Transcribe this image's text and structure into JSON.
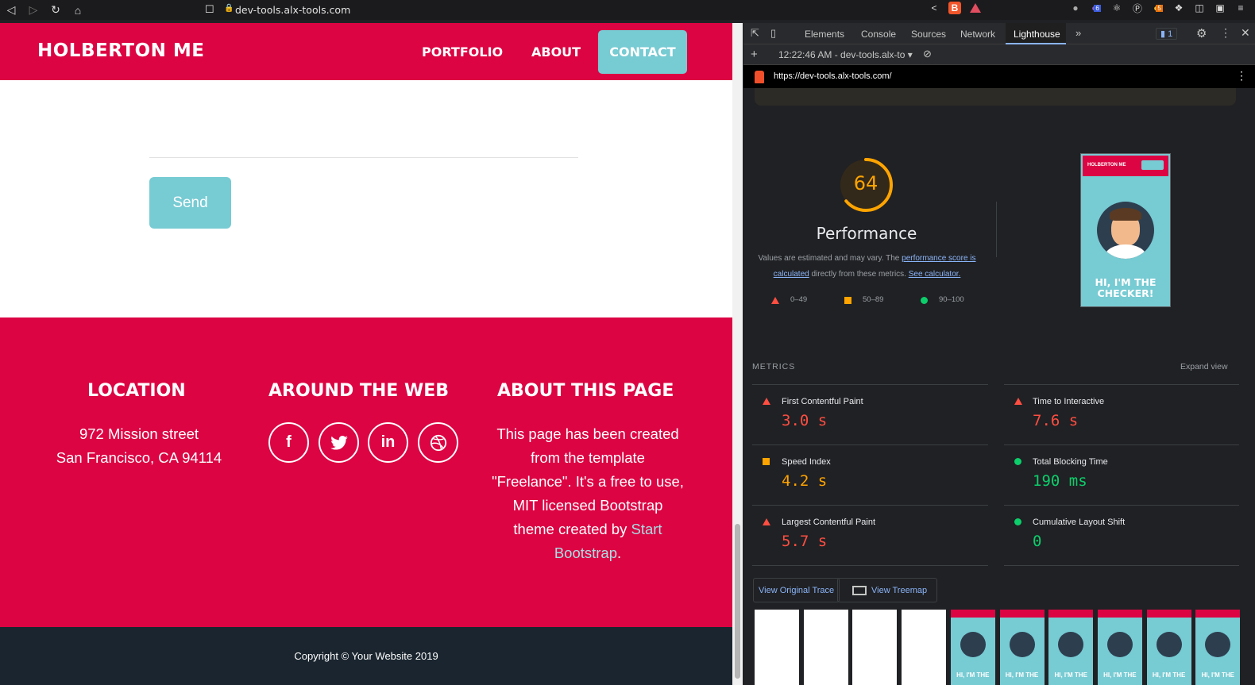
{
  "browser": {
    "url": "dev-tools.alx-tools.com",
    "ext_badges": {
      "purple": "6",
      "bulb": "5"
    }
  },
  "site": {
    "brand": "HOLBERTON ME",
    "nav": {
      "portfolio": "PORTFOLIO",
      "about": "ABOUT",
      "contact": "CONTACT"
    },
    "send_label": "Send",
    "footer": {
      "location_title": "LOCATION",
      "location_line1": "972 Mission street",
      "location_line2": "San Francisco, CA 94114",
      "web_title": "AROUND THE WEB",
      "social": [
        "f",
        "t",
        "in",
        "dribbble"
      ],
      "about_title": "ABOUT THIS PAGE",
      "about_line1": "This page has been created",
      "about_line2": "from the template",
      "about_line3": "\"Freelance\". It's a free to use,",
      "about_line4": "MIT licensed Bootstrap",
      "about_line5_pre": "theme created by",
      "about_link1": "Start",
      "about_link2": "Bootstrap",
      "about_end": "."
    },
    "copyright": "Copyright © Your Website 2019"
  },
  "devtools": {
    "tabs": [
      "Elements",
      "Console",
      "Sources",
      "Network",
      "Lighthouse"
    ],
    "active_tab": "Lighthouse",
    "issues_count": "1",
    "report_time": "12:22:46 AM - dev-tools.alx-to",
    "report_url": "https://dev-tools.alx-tools.com/",
    "score": "64",
    "score_fraction": 0.64,
    "category": "Performance",
    "desc_pre": "Values are estimated and may vary. The",
    "desc_link1a": "performance score is",
    "desc_link1b": "calculated",
    "desc_mid": "directly from these metrics.",
    "desc_link2": "See calculator.",
    "legend": {
      "fail": "0–49",
      "average": "50–89",
      "pass": "90–100"
    },
    "thumb": {
      "brand": "HOLBERTON ME",
      "heading_line1": "HI, I'M THE",
      "heading_line2": "CHECKER!"
    },
    "metrics_title": "METRICS",
    "expand": "Expand view",
    "metrics": [
      {
        "name": "First Contentful Paint",
        "value": "3.0 s"
      },
      {
        "name": "Time to Interactive",
        "value": "7.6 s"
      },
      {
        "name": "Speed Index",
        "value": "4.2 s"
      },
      {
        "name": "Total Blocking Time",
        "value": "190 ms"
      },
      {
        "name": "Largest Contentful Paint",
        "value": "5.7 s"
      },
      {
        "name": "Cumulative Layout Shift",
        "value": "0"
      }
    ],
    "btn_trace": "View Original Trace",
    "btn_treemap": "View Treemap",
    "frame_text": "HI, I'M THE",
    "colors": {
      "fail": "#ff4e42",
      "average": "#ffa400",
      "pass": "#0cce6b"
    }
  }
}
